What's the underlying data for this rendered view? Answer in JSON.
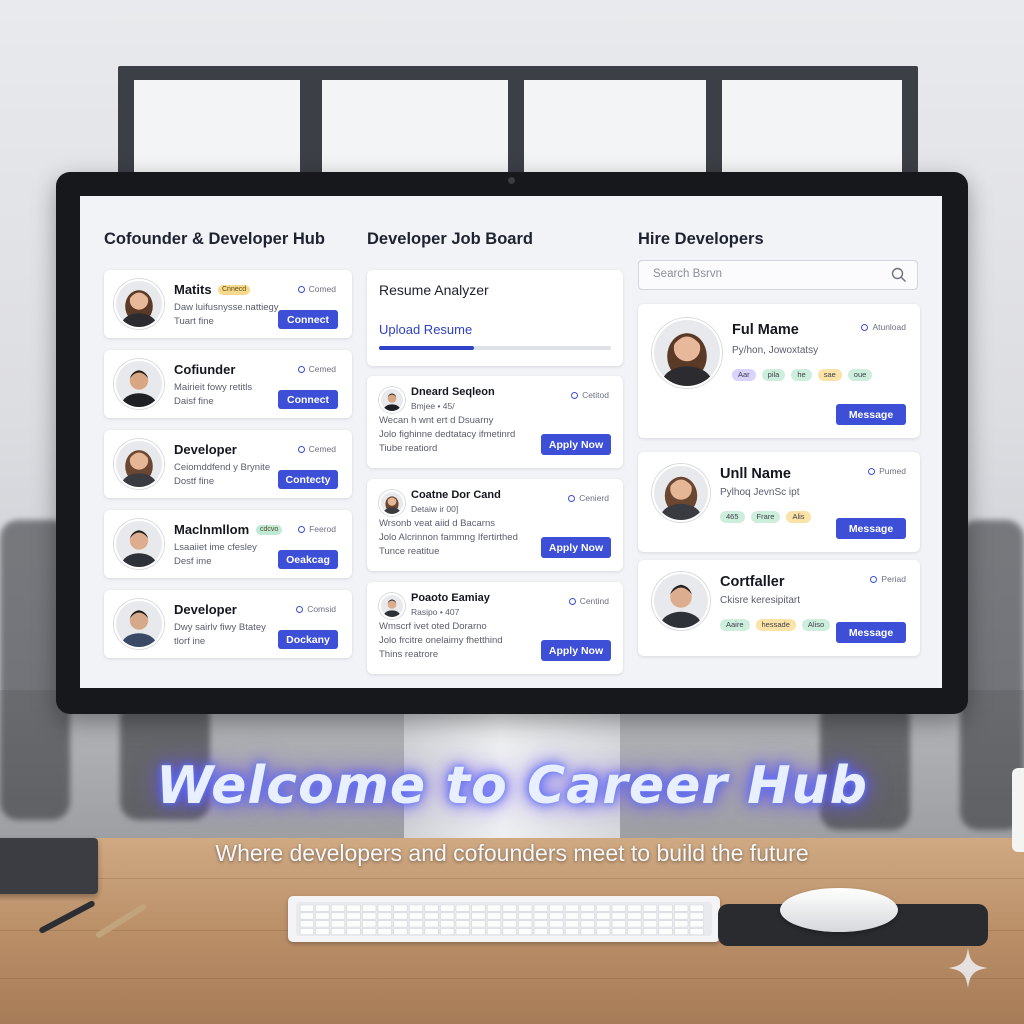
{
  "col1": {
    "title": "Cofounder & Developer Hub",
    "cards": [
      {
        "name": "Matits",
        "badge": "Cnnecd",
        "status": "Comed",
        "line1": "Daw luifusnysse.nattiegy",
        "line2": "Tuart fine",
        "button": "Connect"
      },
      {
        "name": "Cofiunder",
        "status": "Cemed",
        "line1": "Mairieit fowy retitls",
        "line2": "Daisf fine",
        "button": "Connect"
      },
      {
        "name": "Developer",
        "status": "Cemed",
        "line1": "Ceiomddfend y Brynite",
        "line2": "Dostf fine",
        "button": "Contecty"
      },
      {
        "name": "Maclnmllom",
        "badge": "cdcvo",
        "status": "Feerod",
        "line1": "Lsaaiiet ime cfesley",
        "line2": "Desf ime",
        "button": "Oeakcag"
      },
      {
        "name": "Developer",
        "status": "Comsid",
        "line1": "Dwy sairlv fiwy Btatey",
        "line2": "tlorf ine",
        "button": "Dockany"
      }
    ]
  },
  "col2": {
    "title": "Developer Job Board",
    "analyzer": {
      "title": "Resume Analyzer",
      "upload": "Upload Resume",
      "progress": 0.41
    },
    "jobs": [
      {
        "name": "Dneard Seqleon",
        "status": "Cetitod",
        "meta": "Bmjee • 45/",
        "line1": "Wecan h wnt ert d Dsuarny",
        "line2": "Jolo fighinne dedtatacy ifmetinrd",
        "line3": "Tiube reatiord",
        "button": "Apply Now"
      },
      {
        "name": "Coatne Dor Cand",
        "status": "Cenierd",
        "meta": "Detaiw ir 00]",
        "line1": "Wrsonb veat aiid d Bacarns",
        "line2": "Jolo Alcrinnon fammng Ifertirthed",
        "line3": "Tunce reatitue",
        "button": "Apply Now"
      },
      {
        "name": "Poaoto Eamiay",
        "status": "Centind",
        "meta": "Rasipo • 407",
        "line1": "Wmscrf ivet oted Dorarno",
        "line2": "Jolo frcitre onelaimy fhetthind",
        "line3": "Thins reatrore",
        "button": "Apply Now"
      }
    ]
  },
  "col3": {
    "title": "Hire Developers",
    "search_placeholder": "Search Bsrvn",
    "devs": [
      {
        "name": "Ful Mame",
        "status": "Atunload",
        "role": "Py/hon, Jowoxtatsy",
        "tags": [
          "Aar",
          "pila",
          "he",
          "sae",
          "oue"
        ],
        "button": "Message"
      },
      {
        "name": "Unll Name",
        "status": "Pumed",
        "role": "Pylhoq JevnSc ipt",
        "tags": [
          "465",
          "Frare",
          "Alis"
        ],
        "button": "Message"
      },
      {
        "name": "Cortfaller",
        "status": "Periad",
        "role": "Ckisre keresipitart",
        "tags": [
          "Aaire",
          "hessade",
          "Aliso"
        ],
        "button": "Message"
      }
    ]
  },
  "hero": {
    "title": "Welcome to Career Hub",
    "subtitle": "Where developers and cofounders meet to build the future"
  },
  "colors": {
    "accent": "#3c4fd6",
    "badge_yellow": "#f6d98a",
    "badge_green": "#bfead8",
    "tag_purple": "#d9d3fb",
    "tag_green": "#cdeedd",
    "tag_yellow": "#fbe2a6"
  }
}
